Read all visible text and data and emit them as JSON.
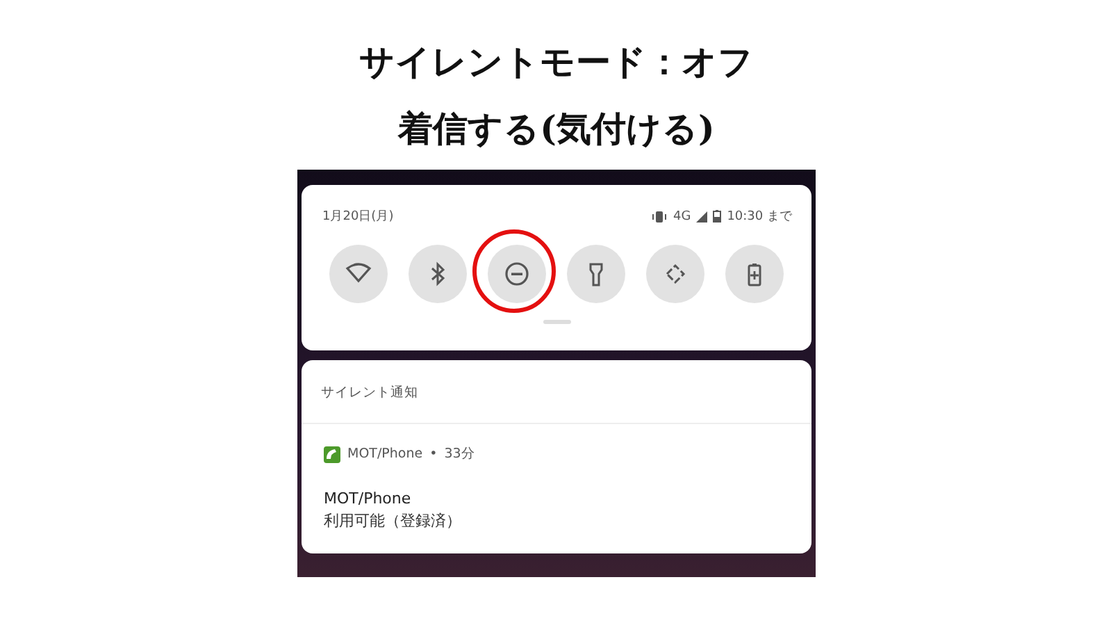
{
  "heading": [
    "サイレントモード：オフ",
    "着信する(気付ける)"
  ],
  "status_bar": {
    "date": "1月20日(月)",
    "network": "4G",
    "until": "10:30 まで"
  },
  "quick_tiles": [
    {
      "kind": "wifi",
      "on": false,
      "highlighted": false
    },
    {
      "kind": "bluetooth",
      "on": false,
      "highlighted": false
    },
    {
      "kind": "dnd",
      "on": false,
      "highlighted": true
    },
    {
      "kind": "flashlight",
      "on": false,
      "highlighted": false
    },
    {
      "kind": "rotate",
      "on": false,
      "highlighted": false
    },
    {
      "kind": "battery",
      "on": false,
      "highlighted": false
    }
  ],
  "notification_section": {
    "title": "サイレント通知",
    "notification": {
      "app": "MOT/Phone",
      "separator": "•",
      "time": "33分",
      "title": "MOT/Phone",
      "text": "利用可能（登録済）"
    }
  }
}
